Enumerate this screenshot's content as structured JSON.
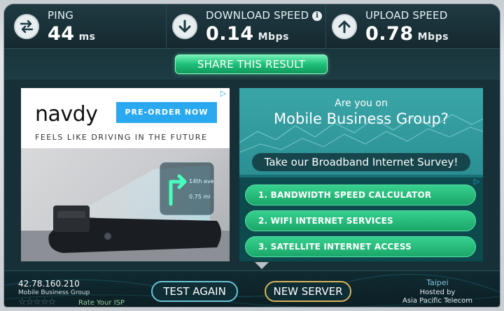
{
  "stats": {
    "ping": {
      "label": "PING",
      "value": "44",
      "unit": "ms",
      "icon": "ping-arrows-icon"
    },
    "download": {
      "label": "DOWNLOAD SPEED",
      "value": "0.14",
      "unit": "Mbps",
      "icon": "download-arrow-icon",
      "info": "i"
    },
    "upload": {
      "label": "UPLOAD SPEED",
      "value": "0.78",
      "unit": "Mbps",
      "icon": "upload-arrow-icon"
    }
  },
  "share_label": "SHARE THIS RESULT",
  "ad_left": {
    "logo": "navdy",
    "cta": "PRE-ORDER NOW",
    "tagline": "FEELS LIKE DRIVING IN THE FUTURE",
    "hud_street": "14th ave",
    "hud_distance": "0.75 mi",
    "adchoices": "▷"
  },
  "ad_right": {
    "are_you": "Are you on",
    "provider": "Mobile Business Group?",
    "survey": "Take our Broadband Internet Survey!",
    "adchoices": "▷",
    "links": [
      "1.  BANDWIDTH SPEED CALCULATOR",
      "2.  WIFI INTERNET SERVICES",
      "3.  SATELLITE INTERNET ACCESS"
    ]
  },
  "bottom": {
    "ip": "42.78.160.210",
    "isp": "Mobile Business Group",
    "stars": "☆☆☆☆☆",
    "rate_isp": "Rate Your ISP",
    "test_again": "TEST AGAIN",
    "new_server": "NEW SERVER",
    "city": "Taipei",
    "hosted_by": "Hosted by",
    "host": "Asia Pacific Telecom"
  },
  "colors": {
    "accent_green": "#1fbf7a",
    "panel_bg": "#173038",
    "new_server_border": "#d8b45a"
  }
}
